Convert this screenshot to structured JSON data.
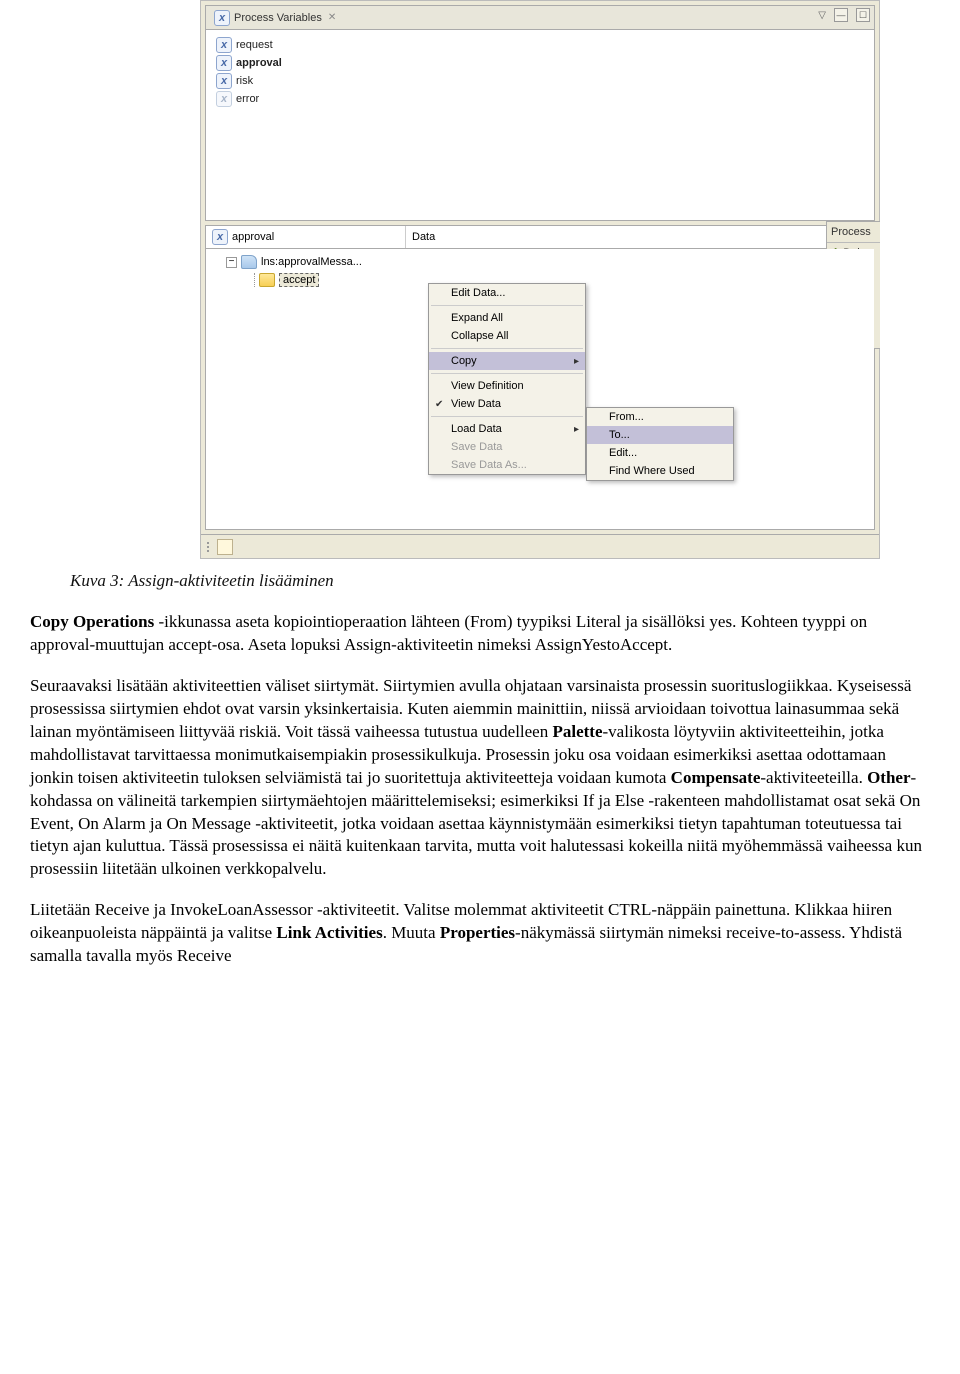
{
  "tabbar": {
    "title": "Process Variables"
  },
  "variables": [
    {
      "name": "request",
      "bold": false,
      "dim": false
    },
    {
      "name": "approval",
      "bold": true,
      "dim": false
    },
    {
      "name": "risk",
      "bold": false,
      "dim": false
    },
    {
      "name": "error",
      "bold": false,
      "dim": true
    }
  ],
  "side": {
    "title": "Process",
    "debug": "Debu"
  },
  "lower_header": {
    "left": "approval",
    "mid": "Data",
    "close": "X"
  },
  "tree": {
    "toggle": "−",
    "msg": "lns:approvalMessa...",
    "leaf": "accept"
  },
  "context_menu": {
    "items": [
      {
        "label": "Edit Data...",
        "type": "item"
      },
      {
        "label": "",
        "type": "sep"
      },
      {
        "label": "Expand All",
        "type": "item"
      },
      {
        "label": "Collapse All",
        "type": "item"
      },
      {
        "label": "",
        "type": "sep"
      },
      {
        "label": "Copy",
        "type": "sub",
        "hover": true
      },
      {
        "label": "",
        "type": "sep"
      },
      {
        "label": "View Definition",
        "type": "item"
      },
      {
        "label": "View Data",
        "type": "item",
        "check": true
      },
      {
        "label": "",
        "type": "sep"
      },
      {
        "label": "Load Data",
        "type": "sub"
      },
      {
        "label": "Save Data",
        "type": "item",
        "disabled": true
      },
      {
        "label": "Save Data As...",
        "type": "item",
        "disabled": true
      }
    ]
  },
  "submenu": [
    {
      "label": "From...",
      "hover": false
    },
    {
      "label": "To...",
      "hover": true
    },
    {
      "label": "Edit...",
      "hover": false
    },
    {
      "label": "Find Where Used",
      "hover": false
    }
  ],
  "caption": "Kuva 3: Assign-aktiviteetin lisääminen",
  "para1_before_bold": "Copy Operations",
  "para1_after_bold": " -ikkunassa aseta kopiointioperaation lähteen (From) tyypiksi Literal ja sisällöksi yes. Kohteen tyyppi on approval-muuttujan accept-osa. Aseta lopuksi Assign-aktiviteetin nimeksi AssignYestoAccept.",
  "para2": {
    "t1": "Seuraavaksi lisätään aktiviteettien väliset siirtymät. Siirtymien avulla ohjataan varsinaista prosessin suorituslogiikkaa. Kyseisessä prosessissa siirtymien ehdot ovat varsin yksinkertaisia. Kuten aiemmin mainittiin, niissä arvioidaan toivottua lainasummaa sekä lainan myöntämiseen liittyvää riskiä. Voit tässä vaiheessa tutustua uudelleen ",
    "b1": "Palette",
    "t2": "-valikosta löytyviin aktiviteetteihin, jotka mahdollistavat tarvittaessa monimutkaisempiakin prosessikulkuja. Prosessin joku osa voidaan esimerkiksi asettaa odottamaan jonkin toisen aktiviteetin tuloksen selviämistä tai jo suoritettuja aktiviteetteja voidaan kumota ",
    "b2": "Compensate",
    "t3": "-aktiviteeteilla. ",
    "b3": "Other",
    "t4": "-kohdassa on välineitä tarkempien siirtymäehtojen määrittelemiseksi; esimerkiksi If ja Else -rakenteen mahdollistamat osat sekä On Event, On Alarm ja On Message -aktiviteetit, jotka voidaan asettaa käynnistymään esimerkiksi tietyn tapahtuman toteutuessa tai tietyn ajan kuluttua. Tässä prosessissa ei näitä kuitenkaan tarvita, mutta voit halutessasi kokeilla niitä myöhemmässä vaiheessa kun prosessiin liitetään ulkoinen verkkopalvelu."
  },
  "para3": {
    "t1": "Liitetään Receive ja InvokeLoanAssessor -aktiviteetit. Valitse molemmat aktiviteetit CTRL-näppäin painettuna. Klikkaa hiiren oikeanpuoleista näppäintä ja valitse ",
    "b1": "Link Activities",
    "t2": ". Muuta ",
    "b2": "Properties",
    "t3": "-näkymässä siirtymän nimeksi receive-to-assess. Yhdistä samalla tavalla myös Receive"
  }
}
